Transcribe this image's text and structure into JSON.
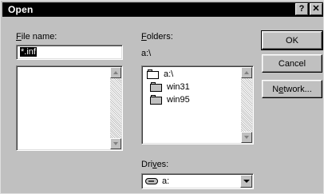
{
  "window": {
    "title": "Open",
    "help_glyph": "?",
    "close_glyph": "✕"
  },
  "file_name": {
    "label_accel": "F",
    "label_rest": "ile name:",
    "value": "*.inf"
  },
  "folders": {
    "label_accel": "F",
    "label_rest": "olders:",
    "current_path": "a:\\",
    "items": [
      "a:\\",
      "win31",
      "win95"
    ]
  },
  "buttons": {
    "ok": "OK",
    "cancel": "Cancel",
    "network_pre": "N",
    "network_accel": "e",
    "network_rest": "twork..."
  },
  "drives": {
    "label_pre": "Dri",
    "label_accel": "v",
    "label_rest": "es:",
    "selected": "a:"
  }
}
